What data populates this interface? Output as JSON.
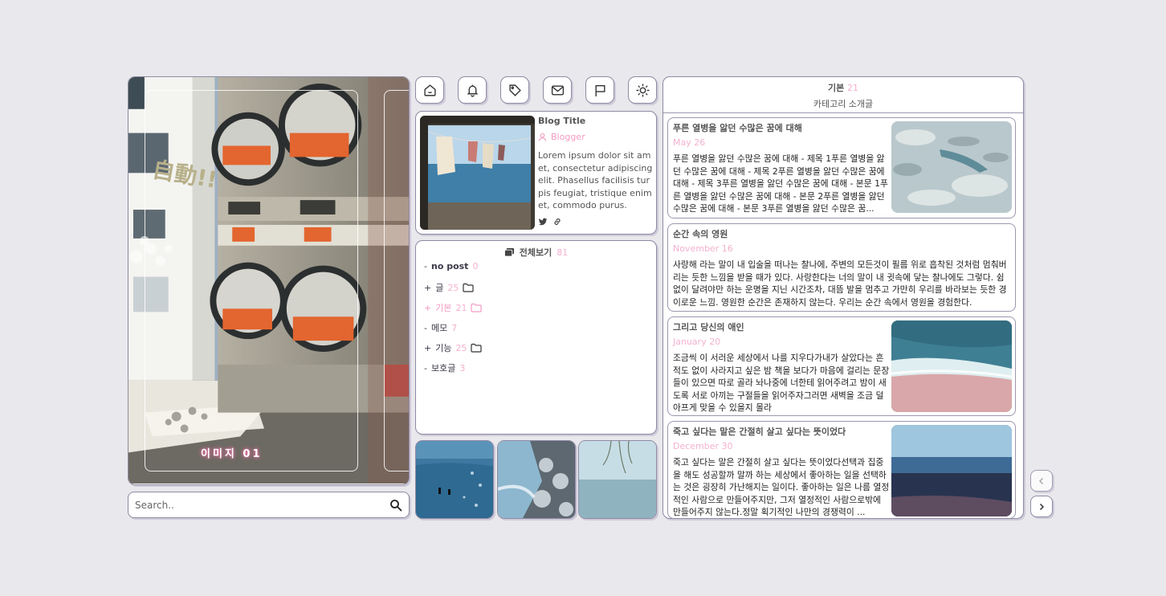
{
  "hero": {
    "caption": "이미지 01",
    "sign_text": "自動!!"
  },
  "search": {
    "placeholder": "Search.."
  },
  "icons": [
    "home-icon",
    "bell-icon",
    "tag-icon",
    "mail-icon",
    "flag-icon",
    "sun-icon"
  ],
  "profile": {
    "title": "Blog Title",
    "role": "Blogger",
    "description": "Lorem ipsum dolor sit amet, consectetur adipiscing elit. Phasellus facilisis turpis feugiat, tristique enim et, commodo purus."
  },
  "categories": {
    "header": "전체보기",
    "total": "81",
    "items": [
      {
        "prefix": "-",
        "name": "no post",
        "count": "0",
        "folder": false,
        "bold": true
      },
      {
        "prefix": "+",
        "name": "글",
        "count": "25",
        "folder": true
      },
      {
        "prefix": "+",
        "name": "기본",
        "count": "21",
        "folder": true,
        "active": true
      },
      {
        "prefix": "-",
        "name": "메모",
        "count": "7",
        "folder": false
      },
      {
        "prefix": "+",
        "name": "기능",
        "count": "25",
        "folder": true
      },
      {
        "prefix": "-",
        "name": "보호글",
        "count": "3",
        "folder": false
      }
    ]
  },
  "posts_panel": {
    "category": "기본",
    "count": "21",
    "description": "카테고리 소개글",
    "posts": [
      {
        "title": "푸른 열병을 앓던 수많은 꿈에 대해",
        "date": "May 26",
        "excerpt": "푸른 열병을 앓던 수많은 꿈에 대해 - 제목 1푸른 열병을 앓던 수많은 꿈에 대해 - 제목 2푸른 열병을 앓던 수많은 꿈에 대해 - 제목 3푸른 열병을 앓던 수많은 꿈에 대해 - 본문 1푸른 열병을 앓던 수많은 꿈에 대해 - 본문 2푸른 열병을 앓던 수많은 꿈에 대해 - 본문 3푸른 열병을 앓던 수많은 꿈...",
        "has_image": true
      },
      {
        "title": "순간 속의 영원",
        "date": "November 16",
        "excerpt": "사랑해 라는 말이 내 입술을 떠나는 찰나에, 주변의 모든것이 필름 위로 흡착된 것처럼 멈춰버리는 듯한 느낌을 받을 때가 있다. 사랑한다는 너의 말이 내 귓속에 닿는 찰나에도 그렇다. 쉼없이 달려야만 하는 운명을 지닌 시간조차, 대뜸 발을 멈추고 가만히 우리를 바라보는 듯한 경이로운 느낌. 영원한 순간은 존재하지 않는다. 우리는 순간 속에서 영원을 경험한다.",
        "has_image": false
      },
      {
        "title": "그리고 당신의 애인",
        "date": "January 20",
        "excerpt": "조금씩 이 서러운 세상에서 나를 지우다가내가 살았다는 흔적도 없이 사라지고 싶은 밤 책을 보다가 마음에 걸리는 문장들이 있으면 따로 골라 놔나중에 너한테 읽어주려고 밤이 새도록 서로 아끼는 구절들을 읽어주자그러면 새벽을 조금 덜 아프게 맞을 수 있을지 몰라",
        "has_image": true
      },
      {
        "title": "죽고 싶다는 말은 간절히 살고 싶다는 뜻이었다",
        "date": "December 30",
        "excerpt": "죽고 싶다는 말은 간절히 살고 싶다는 뜻이었다선택과 집중을 해도 성공할까 말까 하는 세상에서 좋아하는 일을 선택하는 것은 굉장히 가난해지는 일이다. 좋아하는 일은 나름 열정적인 사람으로 만들어주지만, 그저 열정적인 사람으로밖에 만들어주지 않는다.정말 획기적인 나만의 경쟁력이 ...",
        "has_image": true
      }
    ]
  },
  "colors": {
    "accent_pink": "#f4b1cf",
    "border": "#8f8aa3",
    "background": "#e9e8ec"
  }
}
